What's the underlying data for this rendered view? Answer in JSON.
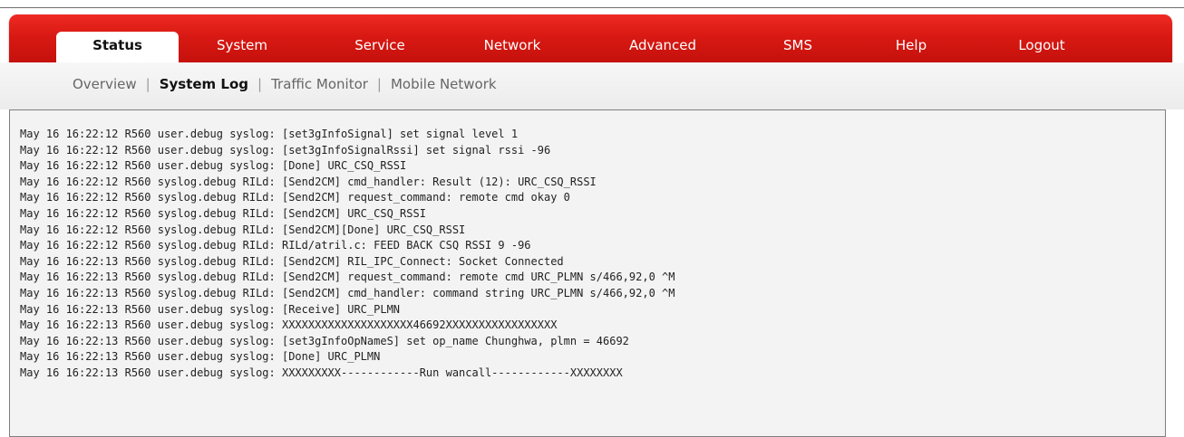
{
  "nav": {
    "tabs": [
      "Status",
      "System",
      "Service",
      "Network",
      "Advanced",
      "SMS",
      "Help",
      "Logout"
    ],
    "active": "Status"
  },
  "subnav": {
    "items": [
      "Overview",
      "System Log",
      "Traffic Monitor",
      "Mobile Network"
    ],
    "active": "System Log",
    "separator": "|"
  },
  "log": {
    "lines": [
      "May 16 16:22:12 R560 user.debug syslog: [set3gInfoSignal] set signal level 1",
      "May 16 16:22:12 R560 user.debug syslog: [set3gInfoSignalRssi] set signal rssi -96",
      "May 16 16:22:12 R560 user.debug syslog: [Done] URC_CSQ_RSSI",
      "May 16 16:22:12 R560 syslog.debug RILd: [Send2CM] cmd_handler: Result (12): URC_CSQ_RSSI",
      "May 16 16:22:12 R560 syslog.debug RILd: [Send2CM] request_command: remote cmd okay 0",
      "May 16 16:22:12 R560 syslog.debug RILd: [Send2CM] URC_CSQ_RSSI",
      "May 16 16:22:12 R560 syslog.debug RILd: [Send2CM][Done] URC_CSQ_RSSI",
      "May 16 16:22:12 R560 syslog.debug RILd: RILd/atril.c: FEED BACK CSQ RSSI 9 -96",
      "May 16 16:22:13 R560 syslog.debug RILd: [Send2CM] RIL_IPC_Connect: Socket Connected",
      "May 16 16:22:13 R560 syslog.debug RILd: [Send2CM] request_command: remote cmd URC_PLMN s/466,92,0 ^M",
      "May 16 16:22:13 R560 syslog.debug RILd: [Send2CM] cmd_handler: command string URC_PLMN s/466,92,0 ^M",
      "May 16 16:22:13 R560 user.debug syslog: [Receive] URC_PLMN",
      "May 16 16:22:13 R560 user.debug syslog: XXXXXXXXXXXXXXXXXXXX46692XXXXXXXXXXXXXXXXX",
      "May 16 16:22:13 R560 user.debug syslog: [set3gInfoOpNameS] set op_name Chunghwa, plmn = 46692",
      "May 16 16:22:13 R560 user.debug syslog: [Done] URC_PLMN",
      "May 16 16:22:13 R560 user.debug syslog: XXXXXXXXX------------Run wancall------------XXXXXXXX"
    ]
  }
}
